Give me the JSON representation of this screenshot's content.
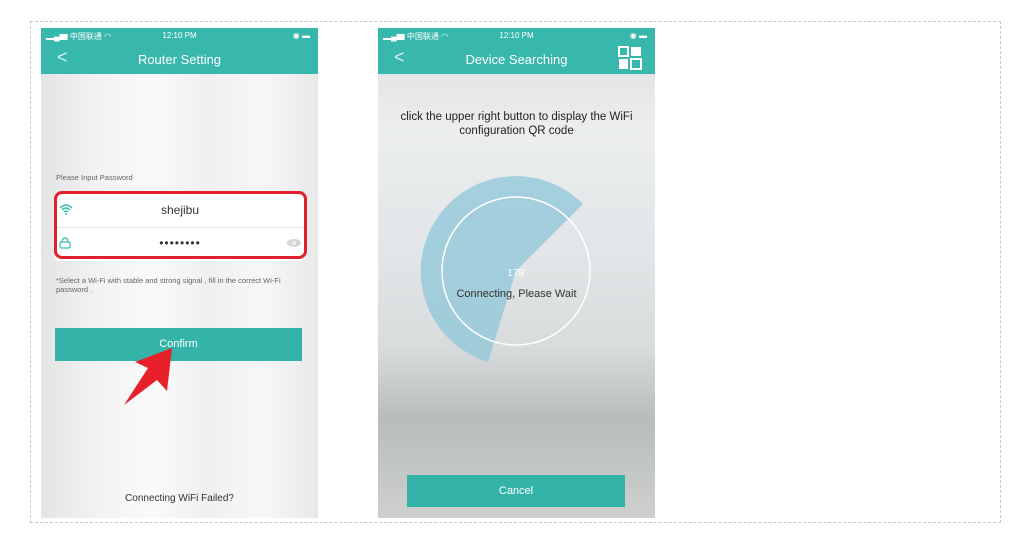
{
  "colors": {
    "accent": "#38b7ac",
    "highlight": "#e0202a"
  },
  "status_bar": {
    "carrier": "中国联通",
    "time": "12:10 PM"
  },
  "router_setting": {
    "title": "Router Setting",
    "back_icon": "chevron-left-icon",
    "password_label": "Please Input Password",
    "ssid": "shejibu",
    "password_masked": "••••••••",
    "hint": "*Select a Wi-Fi with stable and strong signal , fill in the correct Wi-Fi password .",
    "confirm_label": "Confirm",
    "failed_link": "Connecting WiFi Failed?"
  },
  "device_searching": {
    "title": "Device Searching",
    "instruction": "click the upper right button to display the WiFi configuration QR code",
    "countdown": "179'",
    "status": "Connecting, Please Wait",
    "cancel_label": "Cancel"
  }
}
